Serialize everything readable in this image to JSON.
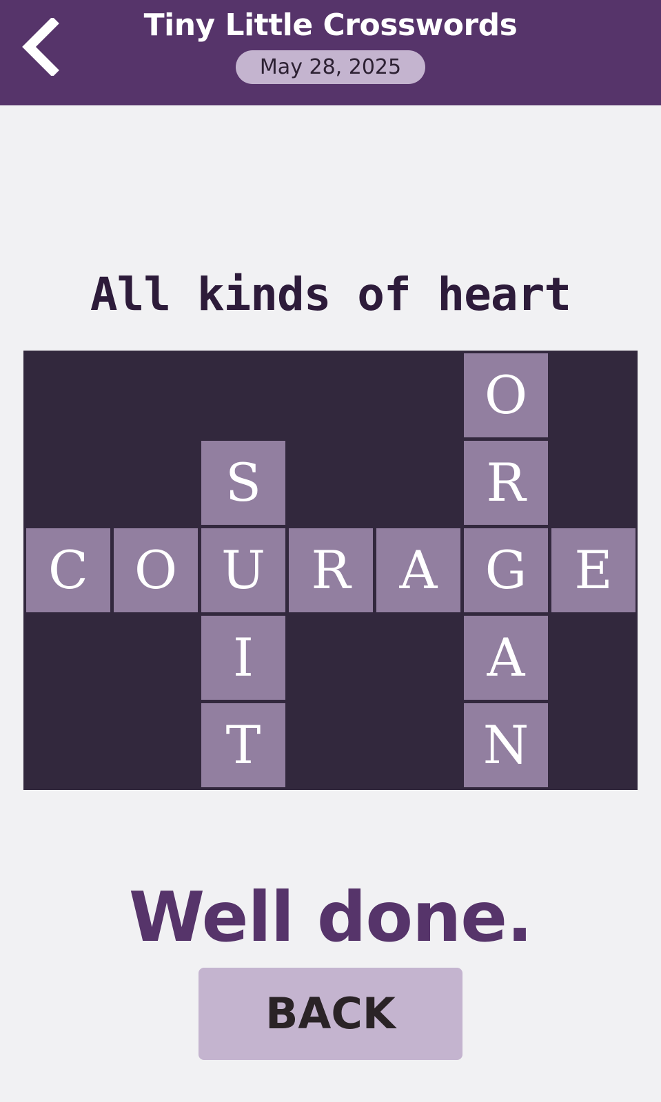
{
  "header": {
    "title": "Tiny Little Crosswords",
    "date": "May 28, 2025",
    "back_icon": "chevron-left-icon"
  },
  "puzzle": {
    "clue": "All kinds of heart",
    "columns": 7,
    "rows": 5,
    "cells": [
      {
        "row": 0,
        "col": 5,
        "letter": "O"
      },
      {
        "row": 1,
        "col": 2,
        "letter": "S"
      },
      {
        "row": 1,
        "col": 5,
        "letter": "R"
      },
      {
        "row": 2,
        "col": 0,
        "letter": "C"
      },
      {
        "row": 2,
        "col": 1,
        "letter": "O"
      },
      {
        "row": 2,
        "col": 2,
        "letter": "U"
      },
      {
        "row": 2,
        "col": 3,
        "letter": "R"
      },
      {
        "row": 2,
        "col": 4,
        "letter": "A"
      },
      {
        "row": 2,
        "col": 5,
        "letter": "G"
      },
      {
        "row": 2,
        "col": 6,
        "letter": "E"
      },
      {
        "row": 3,
        "col": 2,
        "letter": "I"
      },
      {
        "row": 3,
        "col": 5,
        "letter": "A"
      },
      {
        "row": 4,
        "col": 2,
        "letter": "T"
      },
      {
        "row": 4,
        "col": 5,
        "letter": "N"
      }
    ]
  },
  "result": {
    "message": "Well done.",
    "back_label": "BACK"
  },
  "colors": {
    "header": "#56346a",
    "pill": "#c4b4cf",
    "grid_background": "#32283d",
    "cell": "#927fa0",
    "accent_text": "#56346a"
  }
}
